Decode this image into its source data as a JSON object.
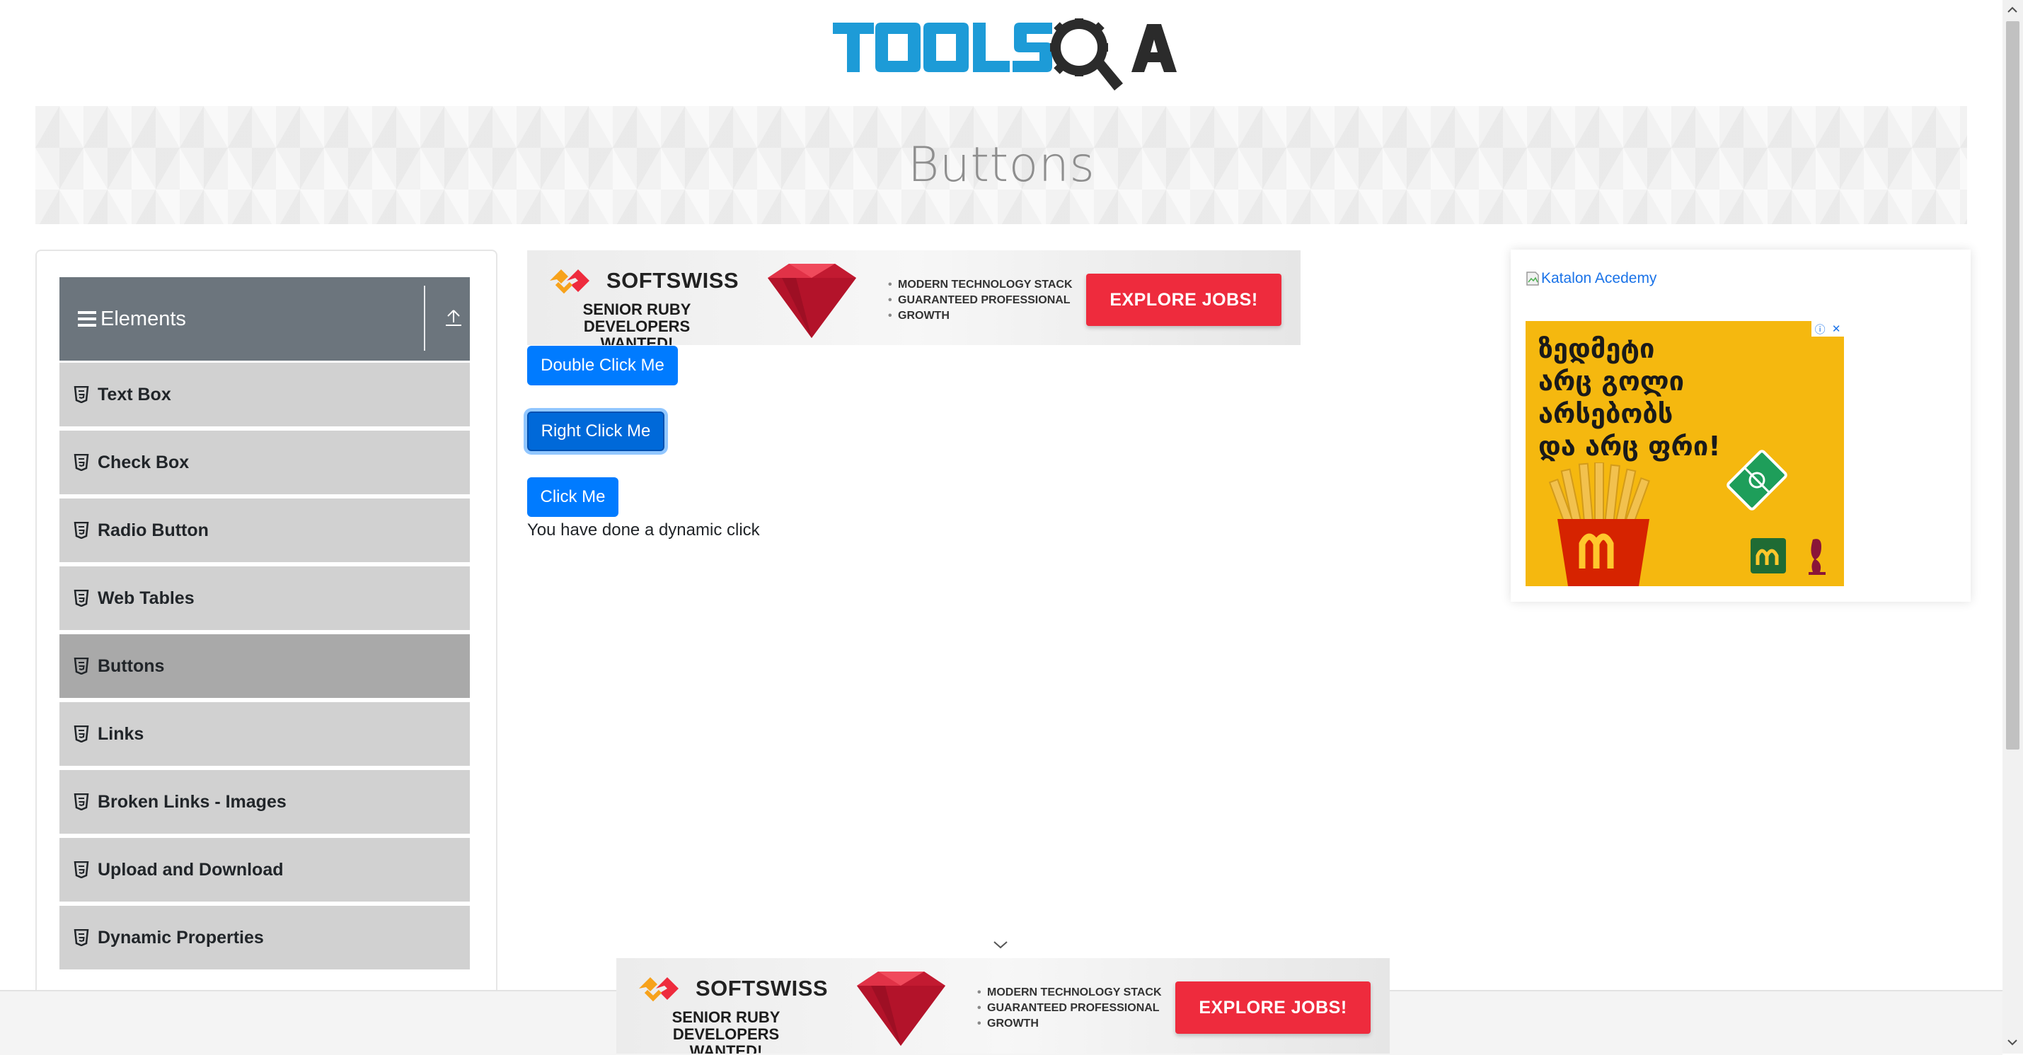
{
  "header": {
    "logo_text": "TOOLSQA"
  },
  "banner": {
    "title": "Buttons"
  },
  "sidebar": {
    "group": {
      "label": "Elements"
    },
    "items": [
      {
        "label": "Text Box"
      },
      {
        "label": "Check Box"
      },
      {
        "label": "Radio Button"
      },
      {
        "label": "Web Tables"
      },
      {
        "label": "Buttons",
        "active": true
      },
      {
        "label": "Links"
      },
      {
        "label": "Broken Links - Images"
      },
      {
        "label": "Upload and Download"
      },
      {
        "label": "Dynamic Properties"
      }
    ]
  },
  "ad_top": {
    "brand": "SOFTSWISS",
    "tagline_1": "SENIOR RUBY",
    "tagline_2": "DEVELOPERS WANTED!",
    "bullet_1": "MODERN TECHNOLOGY STACK",
    "bullet_2": "GUARANTEED PROFESSIONAL",
    "bullet_3": "GROWTH",
    "cta": "EXPLORE JOBS!"
  },
  "ad_bottom": {
    "brand": "SOFTSWISS",
    "tagline_1": "SENIOR RUBY",
    "tagline_2": "DEVELOPERS WANTED!",
    "bullet_1": "MODERN TECHNOLOGY STACK",
    "bullet_2": "GUARANTEED PROFESSIONAL",
    "bullet_3": "GROWTH",
    "cta": "EXPLORE JOBS!"
  },
  "buttons": {
    "double_click": "Double Click Me",
    "right_click": "Right Click Me",
    "click": "Click Me"
  },
  "messages": {
    "dynamic_click": "You have done a dynamic click"
  },
  "right_ad": {
    "image_alt": "Katalon Acedemy",
    "georgian_line_1": "ზედმეტი",
    "georgian_line_2": "არც გოლი",
    "georgian_line_3": "არსებობს",
    "georgian_line_4": "და არც ფრი!"
  },
  "colors": {
    "primary": "#007bff",
    "sidebar_header": "#6c757d",
    "sidebar_item": "#d1d1d1",
    "sidebar_active": "#a9a9a9",
    "cta_red": "#ee2b3d",
    "mcd_yellow": "#f5b80f"
  }
}
